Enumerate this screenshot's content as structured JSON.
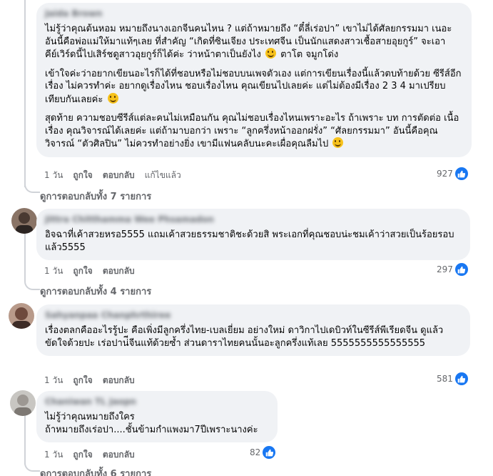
{
  "comments": [
    {
      "author": "Jaida Brown",
      "paragraphs": [
        "ไม่รู้ว่าคุณต้นหอม หมายถึงนางเอกจีนคนไหน ? แต่ถ้าหมายถึง “ตี๋ลี่เร่อปา” เขาไม่ได้ศัลยกรรมมา เนอะ อันนี้คือพ่อแม่ให้มาแท้ๆเลย ที่สำคัญ “เกิดที่ซินเจียง ประเทศจีน เป็นนักแสดงสาวเชื้อสายอุยกูร์” จะเอาคีย์เวิร์ดนี้ไปเสิร์ชดูสาวอุยกูร์ก็ได้ค่ะ ว่าหน้าตาเป็นยังไง",
        "เข้าใจค่ะว่าอยากเขียนอะไรก็ได้ที่ชอบหรือไม่ชอบบนเพจตัวเอง แต่การเขียนเรื่องนี้แล้วตบท้ายด้วย ซีรีส์อีกเรื่อง ไม่ควรทำค่ะ อยากดูเรื่องไหน ชอบเรื่องไหน คุณเขียนไปเลยค่ะ แต่ไม่ต้องมีเรื่อง 2 3 4 มาเปรียบเทียบกันเลยค่ะ",
        "สุดท้าย ความชอบซีรีส์แต่ละคนไม่เหมือนกัน คุณไม่ชอบเรื่องไหนเพราะอะไร ถ้าเพราะ บท การตัดต่อ เนื้อเรื่อง คุณวิจารณ์ได้เลยค่ะ แต่ถ้ามาบอกว่า เพราะ “ลูกครึ่งหน้าออกฝรั่ง” “ศัลยกรรมมา” อันนี้คือคุณวิจารณ์ “ตัวศิลปิน” ไม่ควรทำอย่างยิ่ง เขามีแฟนคลับนะคะเผื่อคุณลืมไป"
      ],
      "p1_tail": "ตาโต จมูกโด่ง",
      "time": "1 วัน",
      "like": "ถูกใจ",
      "reply": "ตอบกลับ",
      "edited": "แก้ไขแล้ว",
      "reaction_count": "927",
      "view_replies": "ดูการตอบกลับทั้ง 7 รายการ"
    },
    {
      "author": "Jittra Chitthamma Wee Phsamadon",
      "paragraphs": [
        "อิจฉาที่เค้าสวยหรอ5555 แถมเค้าสวยธรรมชาติชะด้วยสิ พระเอกที่คุณชอบน่ะชมเค้าว่าสวยเป็นร้อยรอบแล้ว5555"
      ],
      "time": "1 วัน",
      "like": "ถูกใจ",
      "reply": "ตอบกลับ",
      "reaction_count": "297",
      "view_replies": "ดูการตอบกลับทั้ง 4 รายการ"
    },
    {
      "author": "Sahyanpaa Chanphrthiree",
      "paragraphs": [
        "เรื่องตลกคืออะไรรู้ปะ คือเพิ่งมีลูกครึ่งไทย-เบลเยี่ยม อย่างใหม่ ดาวิกาไปเดบิวท์ในซีรีส์พีเรียดจีน ดูแล้วขัดใจด้วยปะ เร่อปาน่ีจีนแท้ด้วยซ้ำ ส่วนดาราไทยคนนั้นอะลูกครึ่งแท้เลย 5555555555555555"
      ],
      "time": "1 วัน",
      "like": "ถูกใจ",
      "reply": "ตอบกลับ",
      "reaction_count": "581"
    },
    {
      "author": "Chaniwan TL Jaopn",
      "paragraphs": [
        "ไม่รู้ว่าคุณหมายถึงใคร",
        "ถ้าหมายถึงเร่อปา....ชั้นข้ามกำแพงมา7ปีเพราะนางค่ะ"
      ],
      "time": "1 วัน",
      "like": "ถูกใจ",
      "reply": "ตอบกลับ",
      "reaction_count": "82",
      "view_replies": "ดูการตอบกลับทั้ง 6 รายการ"
    }
  ],
  "icons": {
    "like": "thumbs-up-icon",
    "reply_arrow": "reply-arrow-icon"
  },
  "colors": {
    "bubble": "#f0f2f5",
    "like_blue": "#1877f2",
    "secondary_text": "#65676b"
  }
}
